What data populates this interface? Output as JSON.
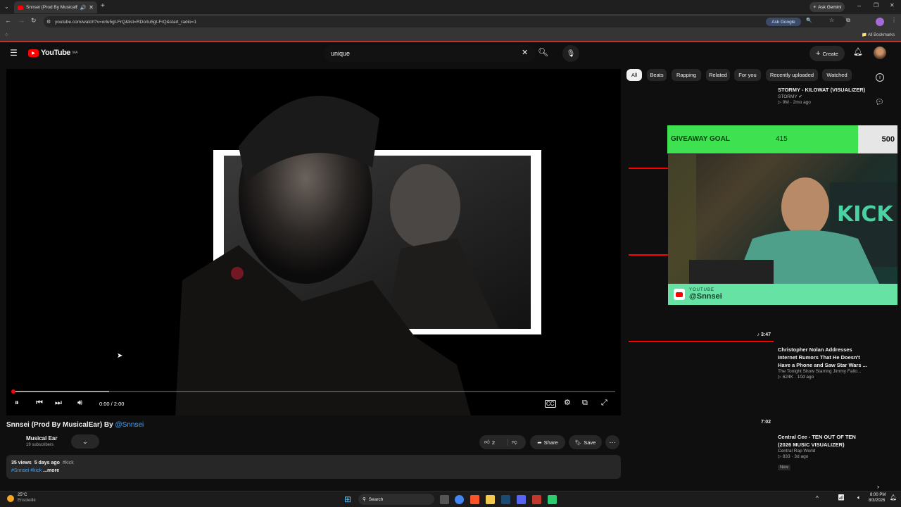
{
  "browser": {
    "tab_title": "Snnsei (Prod By MusicalEar)",
    "url": "youtube.com/watch?v=orlu5gt-FrQ&list=RDorlu5gt-FrQ&start_radio=1",
    "ask_gemini": "Ask Gemini",
    "ask_google": "Ask Google",
    "all_bookmarks": "All Bookmarks"
  },
  "youtube": {
    "logo": "YouTube",
    "country": "MA",
    "search_value": "unique",
    "create_label": "Create"
  },
  "player": {
    "time": "0:00 / 2:00",
    "progress": 0.16
  },
  "video": {
    "title": "Snnsei (Prod By MusicalEar) By ",
    "title_mention": "@Snnsei",
    "channel": "Musical Ear",
    "subscribers": "19 subscribers",
    "likes": "2",
    "share": "Share",
    "save": "Save",
    "views": "35 views",
    "date": "5 days ago",
    "tag": "#kick",
    "tags_line": "#Snnsei #kick",
    "more": "...more"
  },
  "chips": [
    "All",
    "Beats",
    "Rapping",
    "Related",
    "For you",
    "Recently uploaded",
    "Watched"
  ],
  "recommendations": [
    {
      "title": "STORMY - KILOWAT (VISUALIZER)",
      "channel": "STORMY",
      "stats": "9M · 2mo ago",
      "duration": ""
    },
    {
      "title": "Christopher Nolan Addresses Internet Rumors That He Doesn't Have a Phone and Saw Star Wars ...",
      "channel": "The Tonight Show Starring Jimmy Fallo...",
      "stats": "624K · 10d ago",
      "duration": "3:47"
    },
    {
      "title": "Central Cee - TEN OUT OF TEN (2026 MUSIC VISUALIZER)",
      "channel": "Central Rap World",
      "stats": "833 · 3d ago",
      "badge": "New",
      "duration": "7:02"
    }
  ],
  "overlay": {
    "goal_label": "GIVEAWAY GOAL",
    "goal_current": "415",
    "goal_target": "500",
    "goal_progress": 0.83,
    "platform": "YOUTUBE",
    "handle": "@Snnsei"
  },
  "taskbar": {
    "temp": "25°C",
    "weather": "Ensoleillé",
    "search": "Search",
    "time": "8:00 PM",
    "date": "8/3/2026"
  },
  "colors": {
    "accent": "#ff0000",
    "goal_green": "#3ee14f",
    "link": "#3ea6ff"
  }
}
